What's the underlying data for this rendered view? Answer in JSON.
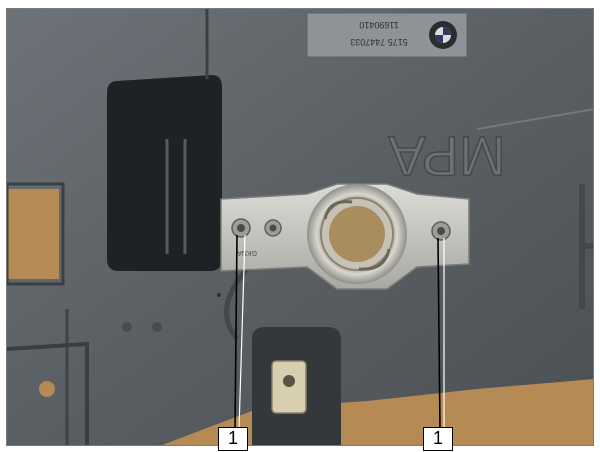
{
  "photo": {
    "label_sticker_line1": "11690410",
    "label_sticker_line2": "5175 7447033",
    "embossed_text": "MPA",
    "bracket_marking": "GKNA"
  },
  "callouts": [
    {
      "number": "1"
    },
    {
      "number": "1"
    }
  ],
  "colors": {
    "panel_plastic": "#5b6064",
    "panel_highlight": "#8a9096",
    "cardboard_background": "#b58a55",
    "metal_bracket": "#c9c9c4",
    "callout_border": "#000000"
  }
}
